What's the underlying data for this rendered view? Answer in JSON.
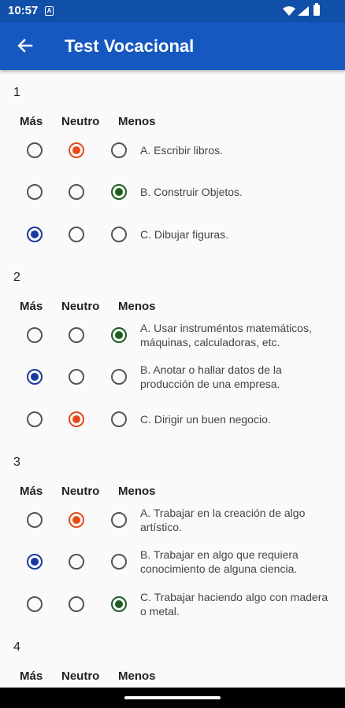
{
  "status_bar": {
    "time": "10:57",
    "notif_letter": "A"
  },
  "app_bar": {
    "title": "Test Vocacional"
  },
  "columns": {
    "mas": "Más",
    "neutro": "Neutro",
    "menos": "Menos"
  },
  "questions": [
    {
      "number": "1",
      "options": [
        {
          "text": "A. Escribir libros.",
          "selected": "neutro"
        },
        {
          "text": "B. Construir Objetos.",
          "selected": "menos"
        },
        {
          "text": "C. Dibujar figuras.",
          "selected": "mas"
        }
      ]
    },
    {
      "number": "2",
      "options": [
        {
          "text": "A. Usar instruméntos matemáticos, máquinas, calculadoras, etc.",
          "selected": "menos"
        },
        {
          "text": "B. Anotar o hallar datos de la producción de una empresa.",
          "selected": "mas"
        },
        {
          "text": "C. Dirigir un buen negocio.",
          "selected": "neutro"
        }
      ]
    },
    {
      "number": "3",
      "options": [
        {
          "text": "A. Trabajar en la creación de algo artístico.",
          "selected": "neutro"
        },
        {
          "text": "B. Trabajar en algo que requiera conocimiento de alguna ciencia.",
          "selected": "mas"
        },
        {
          "text": "C. Trabajar haciendo algo con madera o metal.",
          "selected": "menos"
        }
      ]
    },
    {
      "number": "4",
      "options": []
    }
  ],
  "colors": {
    "mas": "#1a3aa0",
    "neutro": "#e64a19",
    "menos": "#1b5e20",
    "app_bar": "#1558c0"
  },
  "icons": {
    "back": "arrow-back-icon",
    "wifi": "wifi-icon",
    "signal": "signal-icon",
    "battery": "battery-icon"
  }
}
